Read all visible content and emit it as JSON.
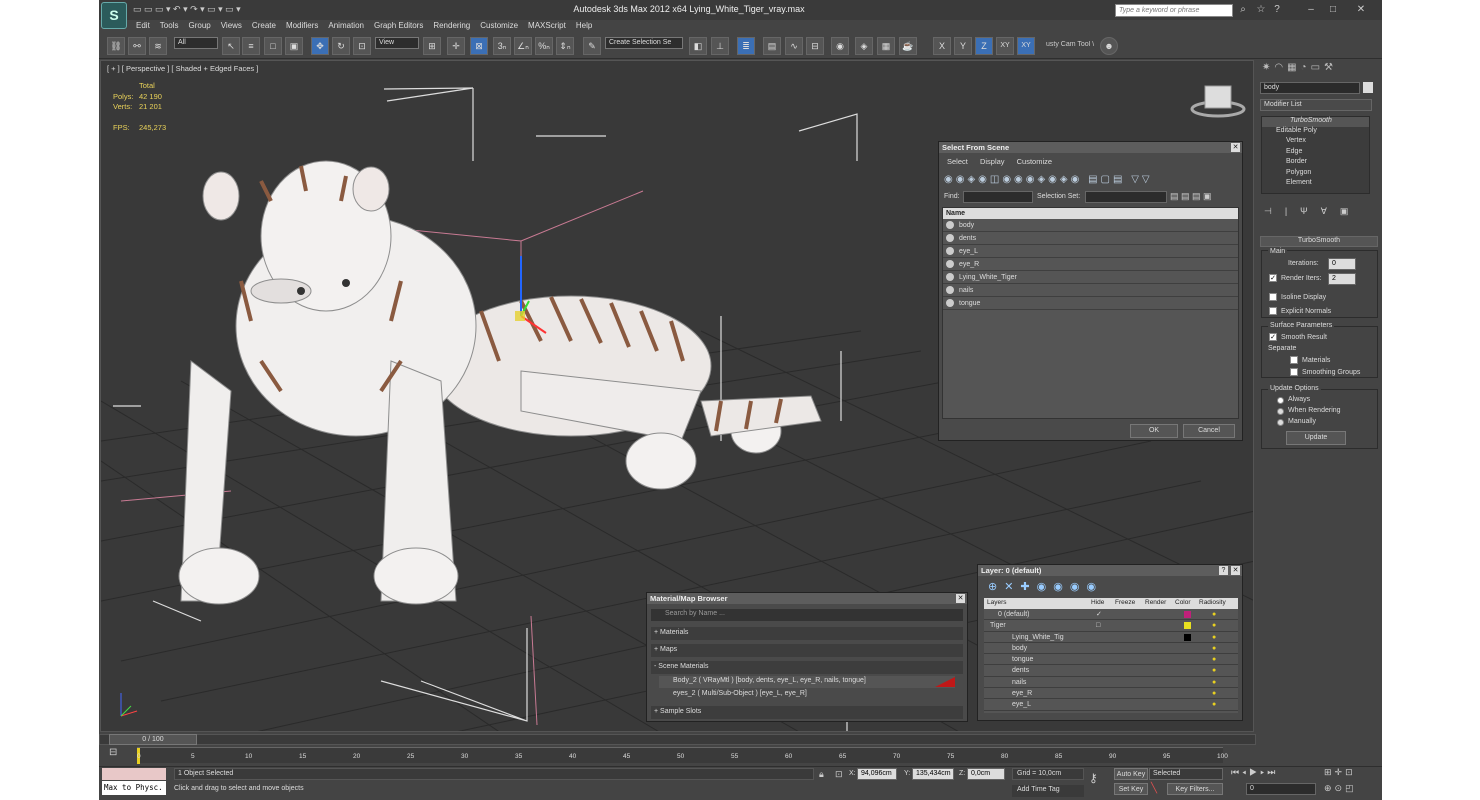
{
  "app": {
    "title": "Autodesk 3ds Max  2012 x64     Lying_White_Tiger_vray.max",
    "search_placeholder": "Type a keyword or phrase"
  },
  "menu": [
    "Edit",
    "Tools",
    "Group",
    "Views",
    "Create",
    "Modifiers",
    "Animation",
    "Graph Editors",
    "Rendering",
    "Customize",
    "MAXScript",
    "Help"
  ],
  "toolbar": {
    "filter": "All",
    "refcoord": "View",
    "selset": "Create Selection Se",
    "axes": [
      "X",
      "Y",
      "Z",
      "XY",
      "XY"
    ],
    "cam_tool": "usty Cam Tool \\"
  },
  "viewport": {
    "label": "[ + ] [ Perspective ] [ Shaded + Edged Faces ]",
    "stats": {
      "total": "Total",
      "polys_label": "Polys:",
      "polys": "42 190",
      "verts_label": "Verts:",
      "verts": "21 201",
      "fps_label": "FPS:",
      "fps": "245,273"
    }
  },
  "select_scene": {
    "title": "Select From Scene",
    "menu": [
      "Select",
      "Display",
      "Customize"
    ],
    "find_label": "Find:",
    "selset_label": "Selection Set:",
    "col_name": "Name",
    "items": [
      "body",
      "dents",
      "eye_L",
      "eye_R",
      "Lying_White_Tiger",
      "nails",
      "tongue"
    ],
    "ok": "OK",
    "cancel": "Cancel"
  },
  "material_browser": {
    "title": "Material/Map Browser",
    "search": "Search by Name ...",
    "sections": [
      "+ Materials",
      "+ Maps",
      "- Scene Materials",
      "+ Sample Slots"
    ],
    "scene_materials": [
      "Body_2  ( VRayMtl ) [body, dents, eye_L, eye_R, nails, tongue]",
      "eyes_2  ( Multi/Sub-Object ) [eye_L, eye_R]"
    ]
  },
  "layer_panel": {
    "title": "Layer: 0 (default)",
    "headers": [
      "Layers",
      "Hide",
      "Freeze",
      "Render",
      "Color",
      "Radiosity"
    ],
    "rows": [
      {
        "name": "0 (default)",
        "color": "#c0207a"
      },
      {
        "name": "Tiger",
        "color": "#e8e020"
      },
      {
        "name": "Lying_White_Tig",
        "color": "#000000"
      },
      {
        "name": "body",
        "color": ""
      },
      {
        "name": "tongue",
        "color": ""
      },
      {
        "name": "dents",
        "color": ""
      },
      {
        "name": "nails",
        "color": ""
      },
      {
        "name": "eye_R",
        "color": ""
      },
      {
        "name": "eye_L",
        "color": ""
      }
    ]
  },
  "command_panel": {
    "object_name": "body",
    "modifier_list": "Modifier List",
    "stack": [
      "TurboSmooth",
      "Editable Poly",
      "Vertex",
      "Edge",
      "Border",
      "Polygon",
      "Element"
    ],
    "ts_title": "TurboSmooth",
    "main": "Main",
    "iterations_label": "Iterations:",
    "iterations": "0",
    "render_iters_label": "Render Iters:",
    "render_iters": "2",
    "isoline": "Isoline Display",
    "explicit": "Explicit Normals",
    "surface_params": "Surface Parameters",
    "smooth_result": "Smooth Result",
    "separate": "Separate",
    "materials": "Materials",
    "smoothing_groups": "Smoothing Groups",
    "update_options": "Update Options",
    "always": "Always",
    "when_rendering": "When Rendering",
    "manually": "Manually",
    "update": "Update"
  },
  "timeline": {
    "frame": "0 / 100",
    "ticks": [
      "0",
      "5",
      "10",
      "15",
      "20",
      "25",
      "30",
      "35",
      "40",
      "45",
      "50",
      "55",
      "60",
      "65",
      "70",
      "75",
      "80",
      "85",
      "90",
      "95",
      "100"
    ]
  },
  "status": {
    "maxscript": "Max to Physc.",
    "selected": "1 Object Selected",
    "prompt": "Click and drag to select and move objects",
    "x_label": "X:",
    "x": "94,096cm",
    "y_label": "Y:",
    "y": "135,434cm",
    "z_label": "Z:",
    "z": "0,0cm",
    "grid": "Grid = 10,0cm",
    "add_time_tag": "Add Time Tag",
    "auto_key": "Auto Key",
    "set_key": "Set Key",
    "key_mode": "Selected",
    "key_filters": "Key Filters...",
    "frame": "0"
  }
}
